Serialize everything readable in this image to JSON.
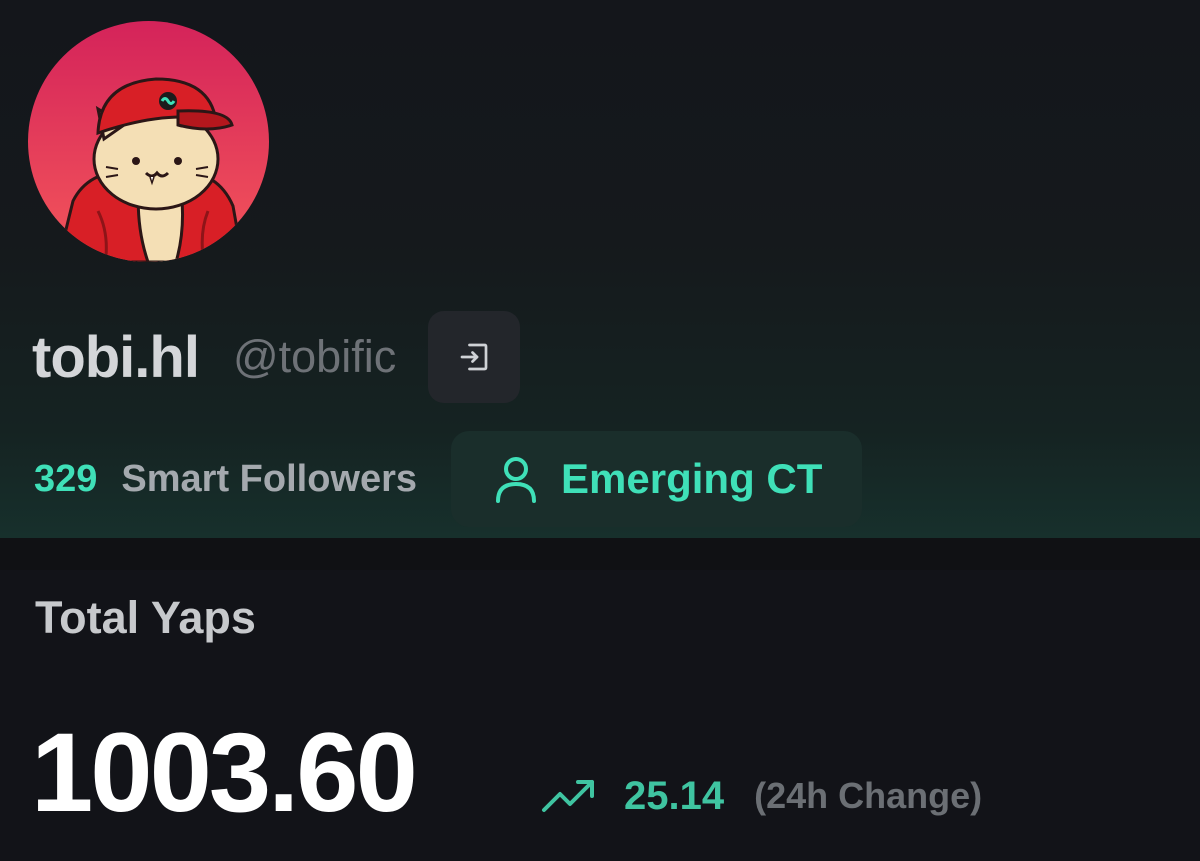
{
  "profile": {
    "display_name": "tobi.hl",
    "handle": "@tobific",
    "avatar_icon": "cat-in-red-cap-avatar",
    "login_icon": "login-icon"
  },
  "followers": {
    "count": "329",
    "label": "Smart Followers"
  },
  "tier": {
    "icon": "user-icon",
    "label": "Emerging CT"
  },
  "yaps": {
    "title": "Total Yaps",
    "total": "1003.60",
    "trend_icon": "trending-up-icon",
    "change": "25.14",
    "change_period": "(24h Change)"
  },
  "colors": {
    "accent": "#3fe0b8",
    "background": "#121318",
    "badge_background": "#1a2e2b",
    "avatar_gradient_top": "#d4235a",
    "avatar_gradient_bottom": "#f4565a"
  }
}
